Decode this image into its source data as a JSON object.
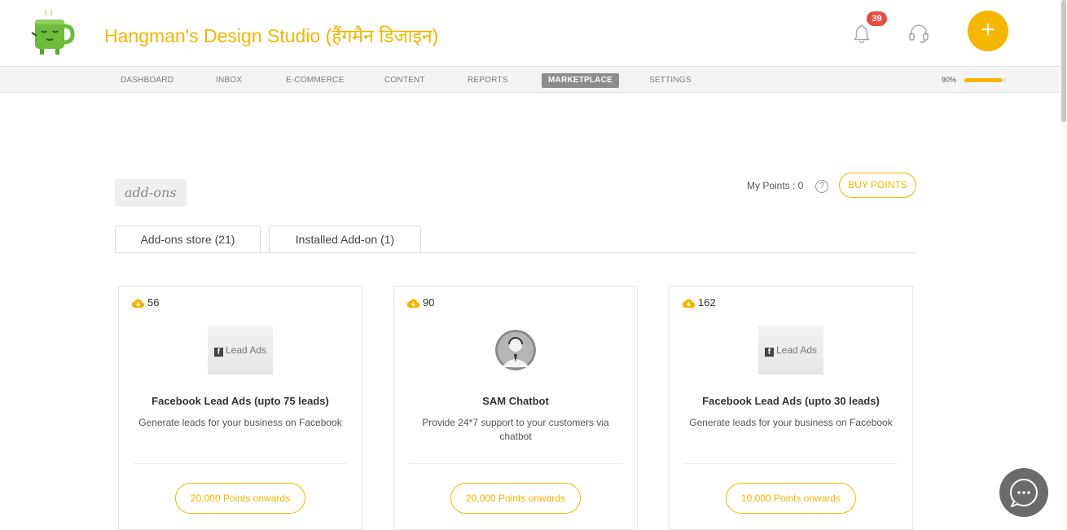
{
  "header": {
    "title": "Hangman's Design Studio (हैंगमैन डिजाइन)",
    "notification_count": "39",
    "add_label": "+"
  },
  "nav": {
    "items": [
      "DASHBOARD",
      "INBOX",
      "E-COMMERCE",
      "CONTENT",
      "REPORTS",
      "MARKETPLACE",
      "SETTINGS"
    ],
    "active": "MARKETPLACE",
    "progress_label": "90%",
    "progress_value": 0.9
  },
  "section": {
    "tag": "add-ons",
    "points_label": "My Points : 0",
    "help": "?",
    "buy_label": "BUY POINTS"
  },
  "tabs": [
    {
      "label": "Add-ons store (21)",
      "active": true
    },
    {
      "label": "Installed Add-on (1)",
      "active": false
    }
  ],
  "cards": [
    {
      "count": "56",
      "thumb_text": "Lead Ads",
      "title": "Facebook Lead Ads (upto 75 leads)",
      "description": "Generate leads for your business on Facebook",
      "price": "20,000 Points onwards"
    },
    {
      "count": "90",
      "thumb_text": "",
      "title": "SAM Chatbot",
      "description": "Provide 24*7 support to your customers via chatbot",
      "price": "20,000 Points onwards"
    },
    {
      "count": "162",
      "thumb_text": "Lead Ads",
      "title": "Facebook Lead Ads (upto 30 leads)",
      "description": "Generate leads for your business on Facebook",
      "price": "10,000 Points onwards"
    }
  ],
  "colors": {
    "accent": "#f5b600",
    "badge": "#e84c3d",
    "nav_active": "#8c8c8c"
  },
  "icons": [
    "mug-logo-icon",
    "bell-icon",
    "headset-icon",
    "plus-icon",
    "help-icon",
    "cloud-download-icon",
    "facebook-icon",
    "avatar-icon",
    "chat-icon"
  ]
}
